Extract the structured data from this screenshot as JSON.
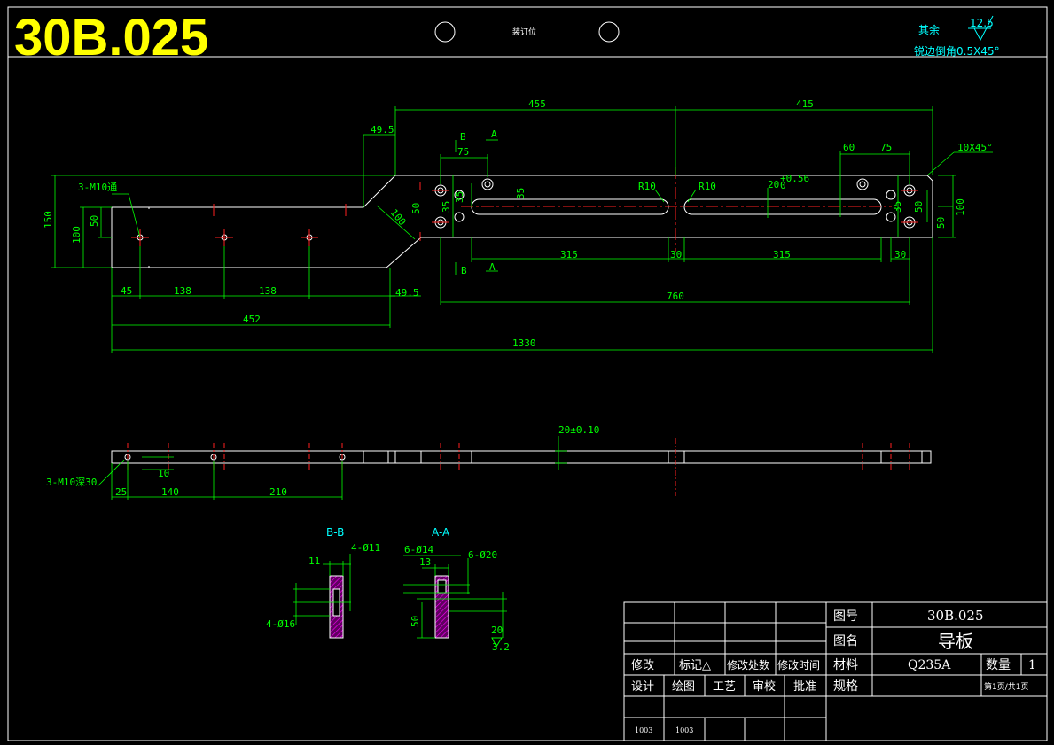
{
  "drawing": {
    "code": "30B.025",
    "binding_mark": "装订位",
    "roughness_note": "其余",
    "roughness_value": "12.5",
    "chamfer_note": "锐边倒角0.5X45°"
  },
  "front_view": {
    "dims_top": [
      "455",
      "415"
    ],
    "dim_49_5_top": "49.5",
    "dim_49_5_bottom": "49.5",
    "section_b": "B",
    "section_a": "A",
    "dim_75_left": "75",
    "dim_60": "60",
    "dim_75_right": "75",
    "chamfer_label": "10X45°",
    "tap_label": "3-M10通",
    "dim_150": "150",
    "dim_100_left": "100",
    "dim_50_left": "50",
    "dim_100_diag": "100",
    "dim_50_a": "50",
    "dim_35_a": "35",
    "dim_35_b": "35",
    "dim_35_c": "35",
    "dim_35_d": "35",
    "dim_50_b": "50",
    "dim_100_right": "100",
    "dim_50_right": "50",
    "r10_left": "R10",
    "r10_right": "R10",
    "tol_20": "20",
    "tol_upper": "+0.56",
    "tol_lower": "0",
    "dim_315_a": "315",
    "dim_30_a": "30",
    "dim_315_b": "315",
    "dim_30_b": "30",
    "dim_45": "45",
    "dim_138_a": "138",
    "dim_138_b": "138",
    "dim_760": "760",
    "dim_452": "452",
    "dim_1330": "1330"
  },
  "side_view": {
    "thickness": "20±0.10",
    "tap_label": "3-M10深30",
    "dim_10": "10",
    "dim_25": "25",
    "dim_140": "140",
    "dim_210": "210"
  },
  "section_views": {
    "bb_title": "B-B",
    "bb_holes": "4-Ø11",
    "bb_dim_11": "11",
    "bb_cbore": "4-Ø16",
    "aa_title": "A-A",
    "aa_holes": "6-Ø14",
    "aa_dim_13": "13",
    "aa_cbore": "6-Ø20",
    "aa_dim_50": "50",
    "aa_dim_20": "20",
    "aa_mark": "3.2"
  },
  "title_block": {
    "drawing_no_label": "图号",
    "drawing_no": "30B.025",
    "name_label": "图名",
    "name": "导板",
    "material_label": "材料",
    "material": "Q235A",
    "qty_label": "数量",
    "qty": "1",
    "spec_label": "规格",
    "sheet": "第1页/共1页",
    "revision_row": [
      "修改",
      "标记△",
      "修改处数",
      "修改时间"
    ],
    "sign_row": [
      "设计",
      "绘图",
      "工艺",
      "审校",
      "批准"
    ],
    "bottom_values": [
      "1003",
      "1003"
    ]
  }
}
